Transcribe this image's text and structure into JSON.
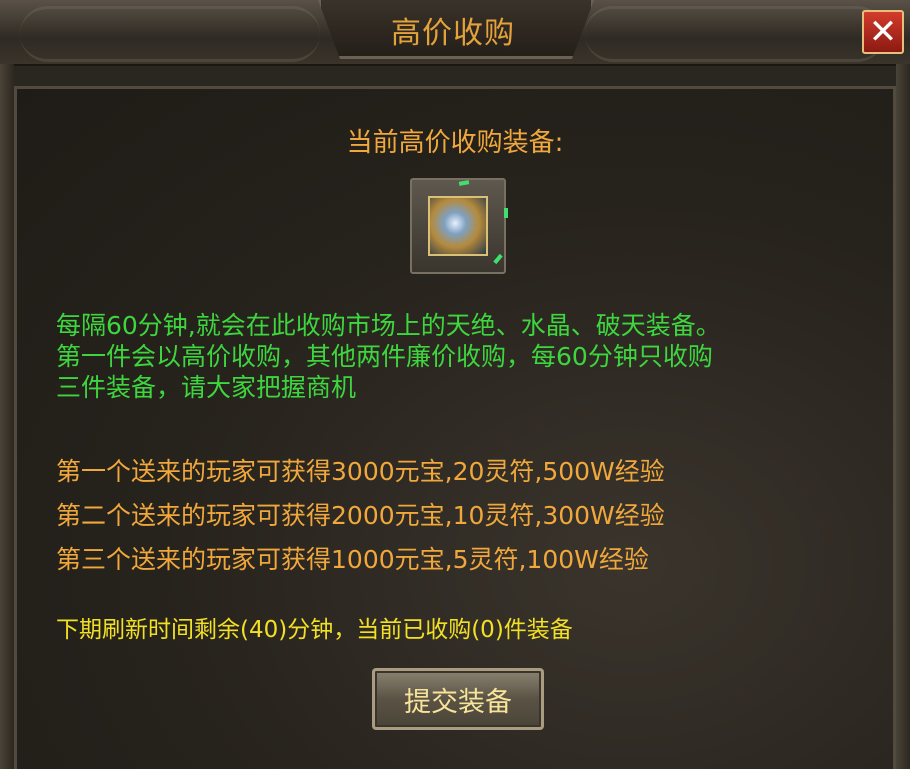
{
  "window": {
    "title": "高价收购",
    "close_icon": "close-icon"
  },
  "heading": "当前高价收购装备:",
  "item": {
    "icon": "armor-item-icon"
  },
  "description": {
    "line1": "每隔60分钟,就会在此收购市场上的天绝、水晶、破天装备。",
    "line2": "第一件会以高价收购，其他两件廉价收购，每60分钟只收购",
    "line3": "三件装备，请大家把握商机"
  },
  "rewards": [
    "第一个送来的玩家可获得3000元宝,20灵符,500W经验",
    "第二个送来的玩家可获得2000元宝,10灵符,300W经验",
    "第三个送来的玩家可获得1000元宝,5灵符,100W经验"
  ],
  "timer_text": "下期刷新时间剩余(40)分钟，当前已收购(0)件装备",
  "submit_label": "提交装备",
  "colors": {
    "title": "#e4a23a",
    "description": "#3ed63e",
    "reward": "#f0a83c",
    "timer": "#f2e025",
    "close_button": "#c8301f"
  }
}
